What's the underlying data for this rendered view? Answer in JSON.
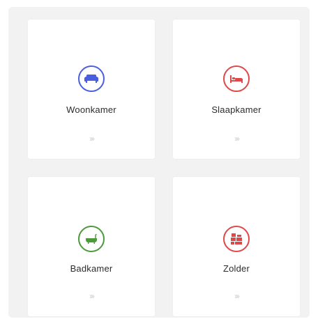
{
  "rooms": [
    {
      "label": "Woonkamer",
      "icon": "sofa-icon",
      "color": "#4a5fe0",
      "arrow": "›››"
    },
    {
      "label": "Slaapkamer",
      "icon": "bed-icon",
      "color": "#e04848",
      "arrow": "›››"
    },
    {
      "label": "Badkamer",
      "icon": "bathtub-icon",
      "color": "#4c9a3a",
      "arrow": "›››"
    },
    {
      "label": "Zolder",
      "icon": "boxes-icon",
      "color": "#e04848",
      "arrow": "›››"
    }
  ]
}
